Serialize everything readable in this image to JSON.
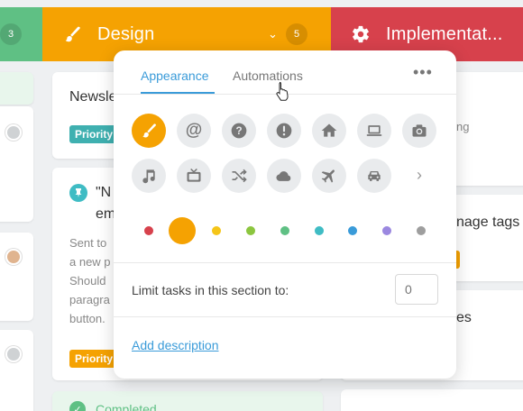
{
  "board": {
    "left_column": {
      "count": "3",
      "color": "#5fc084"
    },
    "design_column": {
      "title": "Design",
      "count": "5",
      "color": "#f5a202",
      "icon": "brush-icon",
      "chevron": "chevron-down-icon"
    },
    "impl_column": {
      "title": "Implementat...",
      "color": "#d7414c",
      "icon": "gear-icon"
    }
  },
  "cards": {
    "newsletter": {
      "title": "Newsle",
      "tag": "Priority"
    },
    "email_card": {
      "title_line1": "\"N",
      "title_line2": "em",
      "desc": "Sent to\na new p\nShould\nparagra\nbutton.",
      "tag": "Priority"
    },
    "completed": {
      "label": "Completed"
    },
    "right_1": {
      "text": "ng"
    },
    "right_2": {
      "text": "nage tags"
    },
    "right_3": {
      "text": "es"
    }
  },
  "popover": {
    "tabs": [
      {
        "label": "Appearance",
        "active": true
      },
      {
        "label": "Automations",
        "active": false
      }
    ],
    "more_label": "•••",
    "icons": [
      "brush-icon",
      "at-sign-icon",
      "question-icon",
      "exclamation-icon",
      "home-icon",
      "laptop-icon",
      "camera-icon",
      "music-note-icon",
      "tv-icon",
      "shuffle-icon",
      "cloud-icon",
      "airplane-icon",
      "car-icon"
    ],
    "selected_icon": "brush-icon",
    "next_label": "›",
    "colors": [
      "#d7414c",
      "#f5a202",
      "#f5c518",
      "#8cc63f",
      "#5fc084",
      "#3fbcc4",
      "#3a9bd9",
      "#9b88e0",
      "#9e9e9e"
    ],
    "selected_color": "#f5a202",
    "limit_label": "Limit tasks in this section to:",
    "limit_placeholder": "0",
    "add_description": "Add description"
  },
  "colors": {
    "accent": "#3a9bd9",
    "priority_teal": "#3fb0b0",
    "priority_orange": "#f5a202",
    "completed_green": "#5fc084"
  }
}
